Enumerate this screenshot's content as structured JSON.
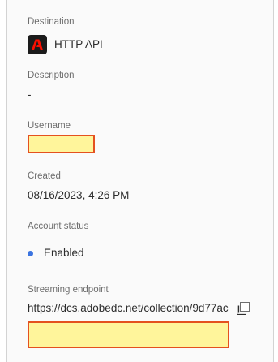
{
  "destination": {
    "label": "Destination",
    "value": "HTTP API",
    "icon": "adobe-logo-icon"
  },
  "description": {
    "label": "Description",
    "value": "-"
  },
  "username": {
    "label": "Username",
    "value": ""
  },
  "created": {
    "label": "Created",
    "value": "08/16/2023, 4:26 PM"
  },
  "account_status": {
    "label": "Account status",
    "value": "Enabled",
    "dot_color": "#3b74e0"
  },
  "streaming_endpoint": {
    "label": "Streaming endpoint",
    "value": "https://dcs.adobedc.net/collection/9d77acc",
    "icon": "copy-icon"
  },
  "colors": {
    "redaction_fill": "#fff59b",
    "redaction_border": "#e4511f"
  }
}
